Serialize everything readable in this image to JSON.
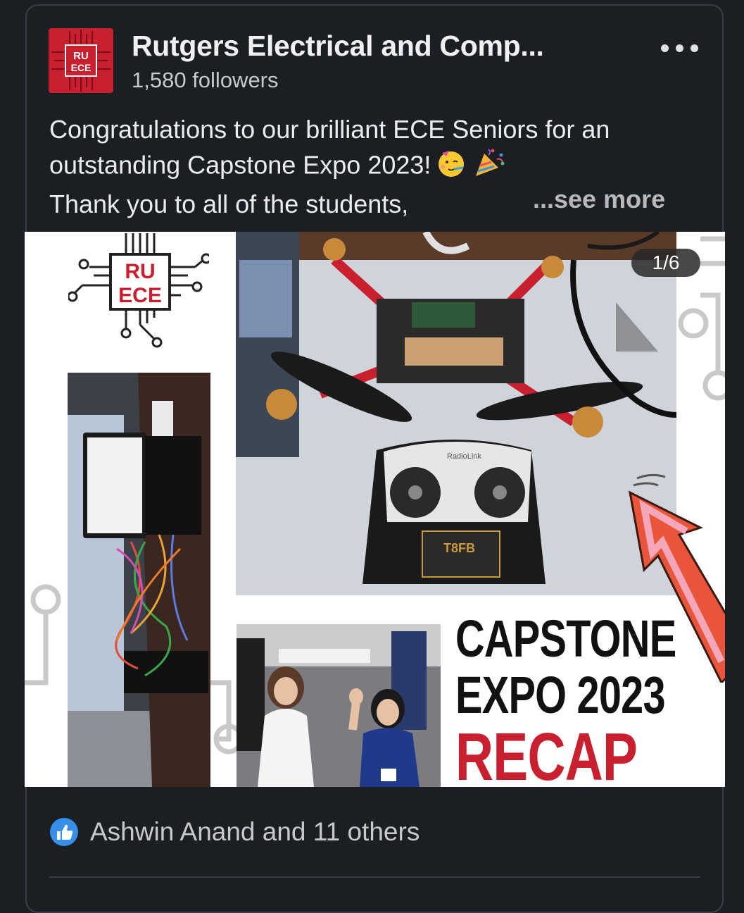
{
  "post": {
    "author": {
      "name": "Rutgers Electrical and Comp...",
      "followers": "1,580 followers",
      "logo_text_top": "RU",
      "logo_text_bottom": "ECE"
    },
    "text_line_1": "Congratulations to our brilliant ECE Seniors for an",
    "text_line_2": "outstanding Capstone Expo 2023!",
    "text_line_3": "Thank you to all of the students,",
    "see_more_label": "...see more",
    "emojis": [
      "partying-face-icon",
      "party-popper-icon"
    ]
  },
  "media": {
    "counter": "1/6",
    "logo_top": "RU",
    "logo_bottom": "ECE",
    "headline_1": "CAPSTONE",
    "headline_2": "EXPO 2023",
    "headline_3": "RECAP",
    "controller_brand": "RadioLink",
    "controller_model": "T8FB"
  },
  "reactions": {
    "text": "Ashwin Anand and 11 others",
    "icon": "like-icon"
  },
  "colors": {
    "background": "#1b1f23",
    "brand_red": "#c8202f",
    "like_blue": "#378fe9",
    "arrow_orange": "#e8553a",
    "arrow_pink": "#f4a7b8"
  }
}
